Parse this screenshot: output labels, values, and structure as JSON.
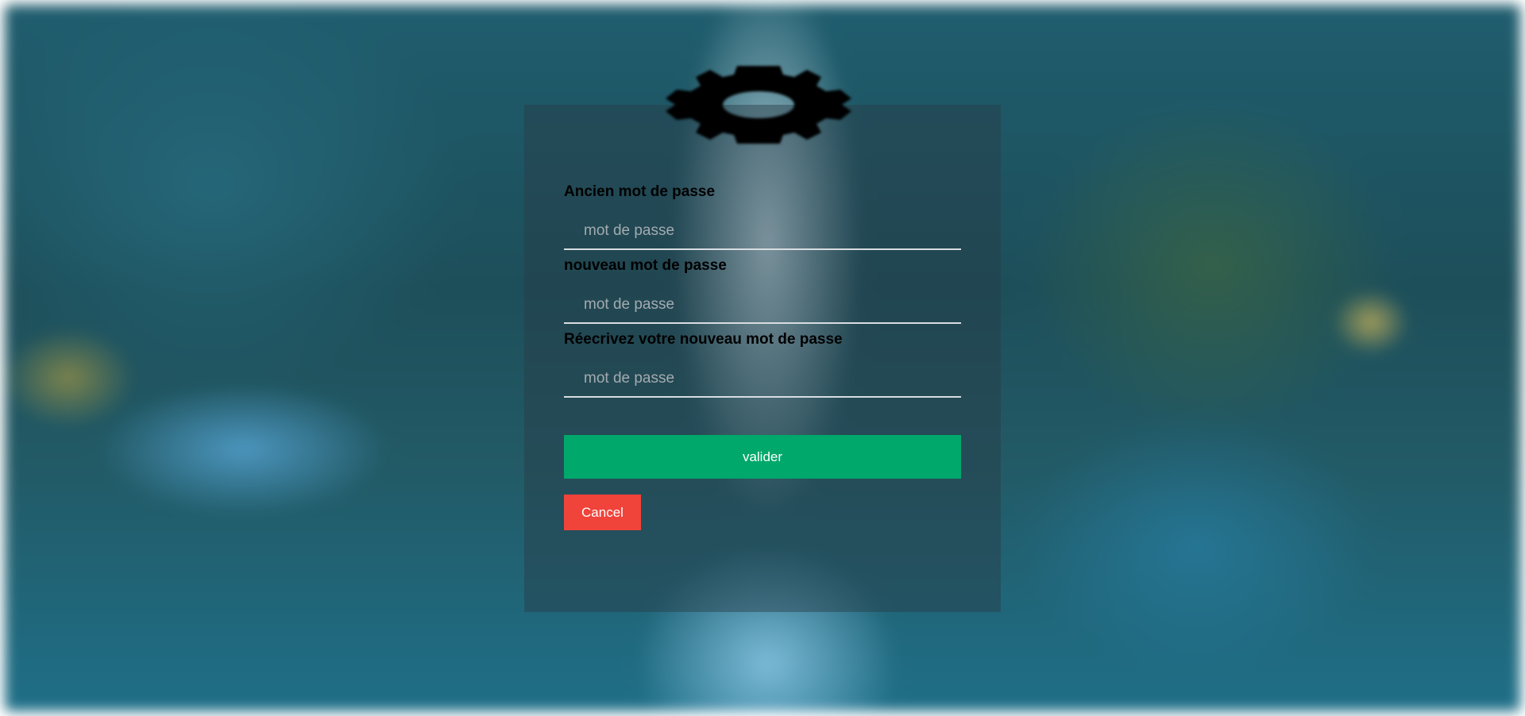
{
  "form": {
    "icon": "gear-icon",
    "fields": [
      {
        "label": "Ancien mot de passe",
        "placeholder": "mot de passe",
        "value": ""
      },
      {
        "label": "nouveau mot de passe",
        "placeholder": "mot de passe",
        "value": ""
      },
      {
        "label": "Réecrivez votre nouveau mot de passe",
        "placeholder": "mot de passe",
        "value": ""
      }
    ],
    "validate_label": "valider",
    "cancel_label": "Cancel"
  },
  "colors": {
    "validate_button": "#00a86b",
    "cancel_button": "#f0433a",
    "card_overlay": "#283c46",
    "input_underline": "#d8dde0"
  }
}
